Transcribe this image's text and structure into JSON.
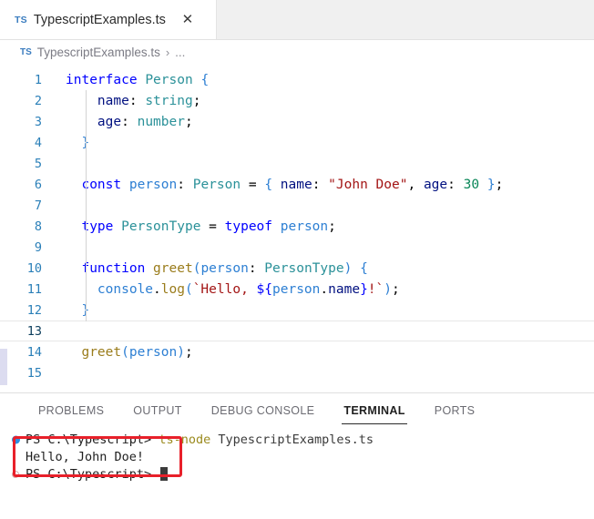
{
  "window": {
    "app": "Visual Studio Code",
    "theme": "light"
  },
  "tabbar": {
    "tabs": [
      {
        "icon": "typescript-file-icon",
        "badge": "TS",
        "label": "TypescriptExamples.ts",
        "close_label": "✕",
        "active": true
      }
    ]
  },
  "breadcrumb": {
    "badge": "TS",
    "file": "TypescriptExamples.ts",
    "separator": "›",
    "overflow": "..."
  },
  "editor": {
    "language": "TypeScript",
    "active_line": 13,
    "lines": [
      {
        "n": "1",
        "tokens": [
          {
            "t": "interface",
            "c": "t-kw"
          },
          {
            "t": " ",
            "c": "t-punct"
          },
          {
            "t": "Person",
            "c": "t-type"
          },
          {
            "t": " ",
            "c": "t-punct"
          },
          {
            "t": "{",
            "c": "t-var"
          }
        ]
      },
      {
        "n": "2",
        "tokens": [
          {
            "t": "    ",
            "c": "t-punct"
          },
          {
            "t": "name",
            "c": "t-prop"
          },
          {
            "t": ": ",
            "c": "t-punct"
          },
          {
            "t": "string",
            "c": "t-type"
          },
          {
            "t": ";",
            "c": "t-punct"
          }
        ]
      },
      {
        "n": "3",
        "tokens": [
          {
            "t": "    ",
            "c": "t-punct"
          },
          {
            "t": "age",
            "c": "t-prop"
          },
          {
            "t": ": ",
            "c": "t-punct"
          },
          {
            "t": "number",
            "c": "t-type"
          },
          {
            "t": ";",
            "c": "t-punct"
          }
        ]
      },
      {
        "n": "4",
        "tokens": [
          {
            "t": "  ",
            "c": "t-punct"
          },
          {
            "t": "}",
            "c": "t-var"
          }
        ]
      },
      {
        "n": "5",
        "tokens": []
      },
      {
        "n": "6",
        "tokens": [
          {
            "t": "  ",
            "c": "t-punct"
          },
          {
            "t": "const",
            "c": "t-kw"
          },
          {
            "t": " ",
            "c": "t-punct"
          },
          {
            "t": "person",
            "c": "t-var"
          },
          {
            "t": ": ",
            "c": "t-punct"
          },
          {
            "t": "Person",
            "c": "t-type"
          },
          {
            "t": " = ",
            "c": "t-punct"
          },
          {
            "t": "{",
            "c": "t-var"
          },
          {
            "t": " ",
            "c": "t-punct"
          },
          {
            "t": "name",
            "c": "t-prop"
          },
          {
            "t": ": ",
            "c": "t-punct"
          },
          {
            "t": "\"John Doe\"",
            "c": "t-str"
          },
          {
            "t": ", ",
            "c": "t-punct"
          },
          {
            "t": "age",
            "c": "t-prop"
          },
          {
            "t": ": ",
            "c": "t-punct"
          },
          {
            "t": "30",
            "c": "t-num"
          },
          {
            "t": " ",
            "c": "t-punct"
          },
          {
            "t": "}",
            "c": "t-var"
          },
          {
            "t": ";",
            "c": "t-punct"
          }
        ]
      },
      {
        "n": "7",
        "tokens": []
      },
      {
        "n": "8",
        "tokens": [
          {
            "t": "  ",
            "c": "t-punct"
          },
          {
            "t": "type",
            "c": "t-kw"
          },
          {
            "t": " ",
            "c": "t-punct"
          },
          {
            "t": "PersonType",
            "c": "t-type"
          },
          {
            "t": " = ",
            "c": "t-punct"
          },
          {
            "t": "typeof",
            "c": "t-kw"
          },
          {
            "t": " ",
            "c": "t-punct"
          },
          {
            "t": "person",
            "c": "t-var"
          },
          {
            "t": ";",
            "c": "t-punct"
          }
        ]
      },
      {
        "n": "9",
        "tokens": []
      },
      {
        "n": "10",
        "tokens": [
          {
            "t": "  ",
            "c": "t-punct"
          },
          {
            "t": "function",
            "c": "t-kw"
          },
          {
            "t": " ",
            "c": "t-punct"
          },
          {
            "t": "greet",
            "c": "t-fn"
          },
          {
            "t": "(",
            "c": "t-var"
          },
          {
            "t": "person",
            "c": "t-var"
          },
          {
            "t": ": ",
            "c": "t-punct"
          },
          {
            "t": "PersonType",
            "c": "t-type"
          },
          {
            "t": ")",
            "c": "t-var"
          },
          {
            "t": " ",
            "c": "t-punct"
          },
          {
            "t": "{",
            "c": "t-var"
          }
        ]
      },
      {
        "n": "11",
        "tokens": [
          {
            "t": "    ",
            "c": "t-punct"
          },
          {
            "t": "console",
            "c": "t-var"
          },
          {
            "t": ".",
            "c": "t-punct"
          },
          {
            "t": "log",
            "c": "t-fn"
          },
          {
            "t": "(",
            "c": "t-var"
          },
          {
            "t": "`Hello, ",
            "c": "t-tmpl"
          },
          {
            "t": "${",
            "c": "t-itp"
          },
          {
            "t": "person",
            "c": "t-var"
          },
          {
            "t": ".",
            "c": "t-punct"
          },
          {
            "t": "name",
            "c": "t-prop"
          },
          {
            "t": "}",
            "c": "t-itp"
          },
          {
            "t": "!`",
            "c": "t-tmpl"
          },
          {
            "t": ")",
            "c": "t-var"
          },
          {
            "t": ";",
            "c": "t-punct"
          }
        ]
      },
      {
        "n": "12",
        "tokens": [
          {
            "t": "  ",
            "c": "t-punct"
          },
          {
            "t": "}",
            "c": "t-var"
          }
        ]
      },
      {
        "n": "13",
        "tokens": []
      },
      {
        "n": "14",
        "tokens": [
          {
            "t": "  ",
            "c": "t-punct"
          },
          {
            "t": "greet",
            "c": "t-fn"
          },
          {
            "t": "(",
            "c": "t-var"
          },
          {
            "t": "person",
            "c": "t-var"
          },
          {
            "t": ")",
            "c": "t-var"
          },
          {
            "t": ";",
            "c": "t-punct"
          }
        ]
      },
      {
        "n": "15",
        "tokens": []
      }
    ]
  },
  "panel": {
    "tabs": [
      {
        "label": "PROBLEMS",
        "active": false
      },
      {
        "label": "OUTPUT",
        "active": false
      },
      {
        "label": "DEBUG CONSOLE",
        "active": false
      },
      {
        "label": "TERMINAL",
        "active": true
      },
      {
        "label": "PORTS",
        "active": false
      }
    ],
    "terminal": {
      "lines": [
        {
          "decoration": "command-success-dot",
          "segments": [
            {
              "t": "PS C:\\Typescript> ",
              "c": "term-out"
            },
            {
              "t": "ts-node",
              "c": "term-cmd"
            },
            {
              "t": " TypescriptExamples.ts",
              "c": "term-arg"
            }
          ]
        },
        {
          "decoration": "none",
          "segments": [
            {
              "t": "Hello, John Doe!",
              "c": "term-out"
            }
          ]
        },
        {
          "decoration": "command-pending-circle",
          "segments": [
            {
              "t": "PS C:\\Typescript> ",
              "c": "term-out"
            }
          ],
          "cursor": true
        }
      ]
    }
  },
  "annotation": {
    "type": "red-rectangle-highlight",
    "target_text": "Hello, John Doe!",
    "color": "#e8202a"
  }
}
